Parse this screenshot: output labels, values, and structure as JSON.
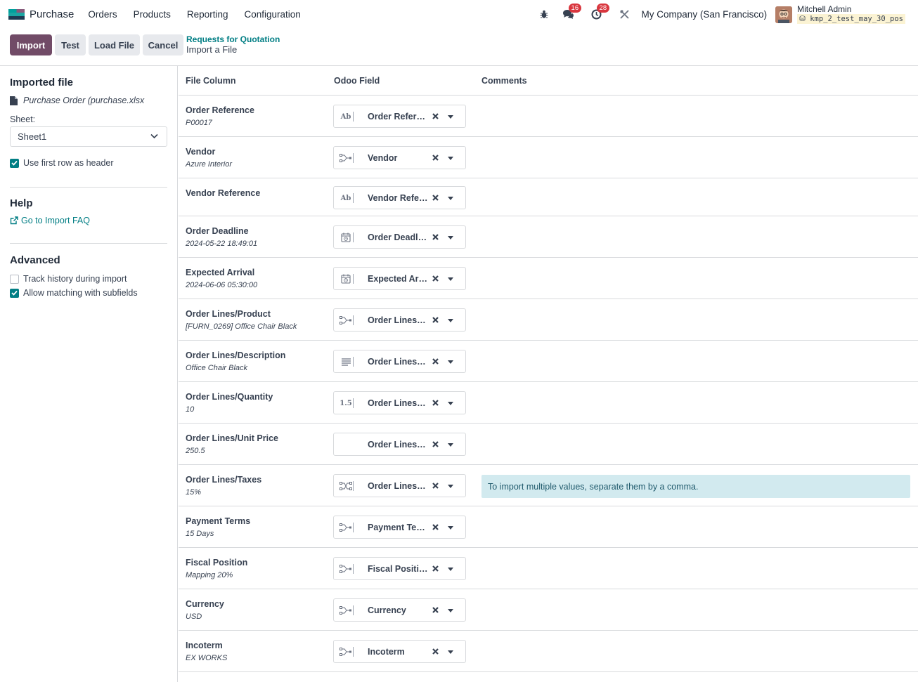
{
  "nav": {
    "app_name": "Purchase",
    "menu": [
      "Orders",
      "Products",
      "Reporting",
      "Configuration"
    ],
    "messages_count": "16",
    "activities_count": "28",
    "company": "My Company (San Francisco)",
    "user_name": "Mitchell Admin",
    "db_name": "kmp_2_test_may_30_pos"
  },
  "control": {
    "import_label": "Import",
    "test_label": "Test",
    "load_file_label": "Load File",
    "cancel_label": "Cancel",
    "breadcrumb_parent": "Requests for Quotation",
    "breadcrumb_current": "Import a File"
  },
  "sidebar": {
    "imported_file_heading": "Imported file",
    "file_name": "Purchase Order (purchase.xlsx",
    "sheet_label": "Sheet:",
    "sheet_value": "Sheet1",
    "use_header_label": "Use first row as header",
    "use_header_checked": true,
    "help_heading": "Help",
    "faq_link": "Go to Import FAQ",
    "advanced_heading": "Advanced",
    "track_history_label": "Track history during import",
    "track_history_checked": false,
    "allow_matching_label": "Allow matching with subfields",
    "allow_matching_checked": true
  },
  "table": {
    "headers": {
      "file_column": "File Column",
      "odoo_field": "Odoo Field",
      "comments": "Comments"
    },
    "rows": [
      {
        "column": "Order Reference",
        "sample": "P00017",
        "field": "Order Reference",
        "field_type": "char-icon",
        "comment": ""
      },
      {
        "column": "Vendor",
        "sample": "Azure Interior",
        "field": "Vendor",
        "field_type": "many2one-icon",
        "comment": ""
      },
      {
        "column": "Vendor Reference",
        "sample": "",
        "field": "Vendor Reference",
        "field_type": "char-icon",
        "comment": ""
      },
      {
        "column": "Order Deadline",
        "sample": "2024-05-22 18:49:01",
        "field": "Order Deadline",
        "field_type": "datetime-icon",
        "comment": ""
      },
      {
        "column": "Expected Arrival",
        "sample": "2024-06-06 05:30:00",
        "field": "Expected Arrival",
        "field_type": "datetime-icon",
        "comment": ""
      },
      {
        "column": "Order Lines/Product",
        "sample": "[FURN_0269] Office Chair Black",
        "field": "Order Lines / Product",
        "field_type": "many2one-icon",
        "comment": ""
      },
      {
        "column": "Order Lines/Description",
        "sample": "Office Chair Black",
        "field": "Order Lines / Description",
        "field_type": "text-icon",
        "comment": ""
      },
      {
        "column": "Order Lines/Quantity",
        "sample": "10",
        "field": "Order Lines / Quantity",
        "field_type": "float-icon",
        "comment": ""
      },
      {
        "column": "Order Lines/Unit Price",
        "sample": "250.5",
        "field": "Order Lines / Unit Price",
        "field_type": "monetary-icon",
        "comment": ""
      },
      {
        "column": "Order Lines/Taxes",
        "sample": "15%",
        "field": "Order Lines / Taxes",
        "field_type": "many2many-icon",
        "comment": "To import multiple values, separate them by a comma."
      },
      {
        "column": "Payment Terms",
        "sample": "15 Days",
        "field": "Payment Terms",
        "field_type": "many2one-icon",
        "comment": ""
      },
      {
        "column": "Fiscal Position",
        "sample": "Mapping 20%",
        "field": "Fiscal Position",
        "field_type": "many2one-icon",
        "comment": ""
      },
      {
        "column": "Currency",
        "sample": "USD",
        "field": "Currency",
        "field_type": "many2one-icon",
        "comment": ""
      },
      {
        "column": "Incoterm",
        "sample": "EX WORKS",
        "field": "Incoterm",
        "field_type": "many2one-icon",
        "comment": ""
      }
    ]
  },
  "colors": {
    "primary": "#714b67",
    "link": "#017e84",
    "badge": "#d9363e",
    "info_bg": "#d2eaef"
  }
}
